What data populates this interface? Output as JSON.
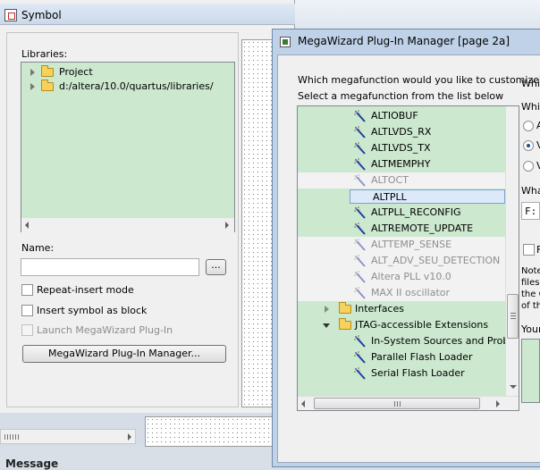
{
  "background": {
    "bottom_label": "Message"
  },
  "symbol_window": {
    "title": "Symbol",
    "libraries_label": "Libraries:",
    "libraries": [
      {
        "label": "Project"
      },
      {
        "label": "d:/altera/10.0/quartus/libraries/"
      }
    ],
    "name_label": "Name:",
    "name_value": "",
    "browse_label": "...",
    "checkboxes": {
      "repeat_insert": "Repeat-insert mode",
      "insert_as_block": "Insert symbol as block",
      "launch_megawizard": "Launch MegaWizard Plug-In"
    },
    "megawizard_button": "MegaWizard Plug-In Manager..."
  },
  "megawizard_window": {
    "title": "MegaWizard Plug-In Manager [page 2a]",
    "question": "Which megafunction would you like to customize?",
    "instruction": "Select a megafunction from the list below",
    "list_items": [
      {
        "label": "ALTIOBUF",
        "state": "available"
      },
      {
        "label": "ALTLVDS_RX",
        "state": "available"
      },
      {
        "label": "ALTLVDS_TX",
        "state": "available"
      },
      {
        "label": "ALTMEMPHY",
        "state": "available"
      },
      {
        "label": "ALTOCT",
        "state": "unavailable"
      },
      {
        "label": "ALTPLL",
        "state": "selected"
      },
      {
        "label": "ALTPLL_RECONFIG",
        "state": "available"
      },
      {
        "label": "ALTREMOTE_UPDATE",
        "state": "available"
      },
      {
        "label": "ALTTEMP_SENSE",
        "state": "unavailable"
      },
      {
        "label": "ALT_ADV_SEU_DETECTION",
        "state": "unavailable"
      },
      {
        "label": "Altera PLL v10.0",
        "state": "unavailable"
      },
      {
        "label": "MAX II oscillator",
        "state": "unavailable"
      }
    ],
    "groups": [
      {
        "label": "Interfaces",
        "expanded": false
      },
      {
        "label": "JTAG-accessible Extensions",
        "expanded": true
      }
    ],
    "jtag_items": [
      {
        "label": "In-System Sources and Probes"
      },
      {
        "label": "Parallel Flash Loader"
      },
      {
        "label": "Serial Flash Loader"
      }
    ],
    "right_column": {
      "which_label_1": "Whic",
      "which_label_2": "Whic",
      "radio_1": "A",
      "radio_2": "V",
      "radio_3": "V",
      "what_label": "What",
      "path_value": "F:/",
      "check_label": "F",
      "note_lines": [
        "Note",
        "files",
        "the C",
        "of th"
      ],
      "your_label": "Your"
    }
  }
}
